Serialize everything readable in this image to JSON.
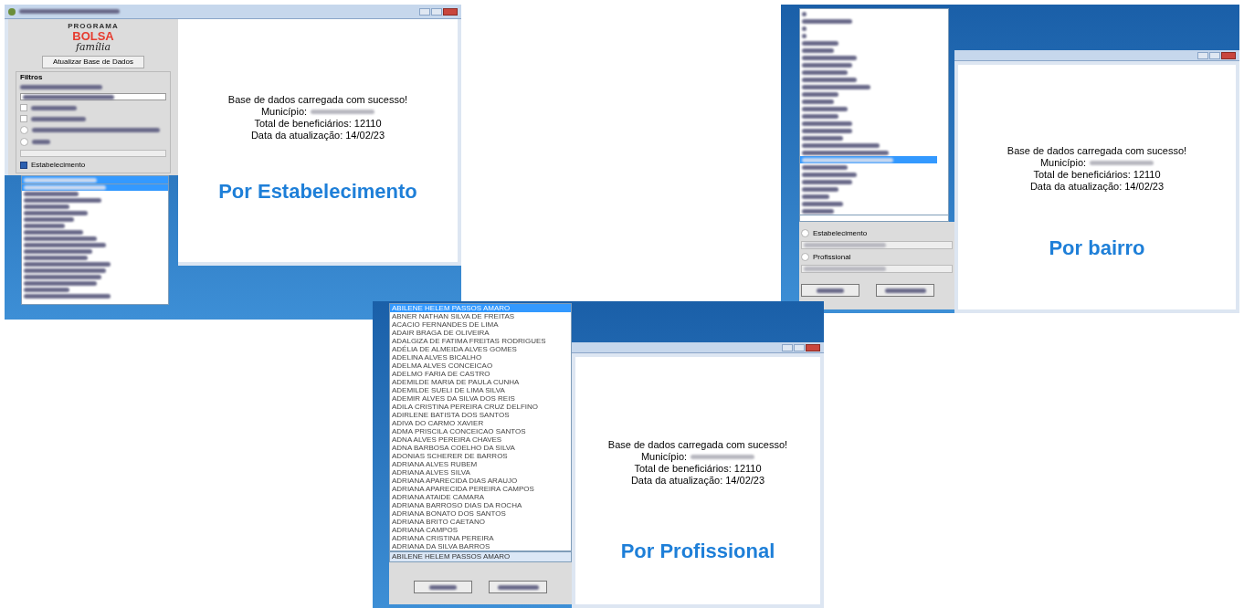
{
  "screens": [
    {
      "kind": "establishment",
      "logo": {
        "top": "PROGRAMA",
        "main": "BOLSA",
        "script": "família"
      },
      "update_button": "Atualizar Base de Dados",
      "filter_group": "Filtros",
      "options": [
        {
          "kind": "checkbox",
          "checked": false
        },
        {
          "kind": "checkbox",
          "checked": false
        },
        {
          "kind": "radio",
          "selected": false
        },
        {
          "kind": "radio",
          "selected": false
        }
      ],
      "filter_option": {
        "label": "Estabelecimento",
        "checked": true
      },
      "dropdown_items": [
        {
          "selected": true
        },
        {
          "selected": false
        },
        {
          "selected": false
        },
        {
          "selected": false
        },
        {
          "selected": false
        },
        {
          "selected": false
        },
        {
          "selected": false
        },
        {
          "selected": false
        },
        {
          "selected": false
        },
        {
          "selected": false
        },
        {
          "selected": false
        },
        {
          "selected": false
        },
        {
          "selected": false
        },
        {
          "selected": false
        },
        {
          "selected": false
        },
        {
          "selected": false
        },
        {
          "selected": false
        },
        {
          "selected": false
        }
      ],
      "message": {
        "loaded": "Base de dados carregada com sucesso!",
        "municipality_label": "Município:",
        "total": "Total de beneficiários: 12110",
        "date": "Data da atualização: 14/02/23"
      },
      "caption": "Por Estabelecimento"
    },
    {
      "kind": "neighborhood",
      "dropdown_items": [
        {
          "selected": false
        },
        {
          "selected": false
        },
        {
          "selected": false
        },
        {
          "selected": false
        },
        {
          "selected": false
        },
        {
          "selected": false
        },
        {
          "selected": false
        },
        {
          "selected": false
        },
        {
          "selected": false
        },
        {
          "selected": false
        },
        {
          "selected": false
        },
        {
          "selected": false
        },
        {
          "selected": false
        },
        {
          "selected": false
        },
        {
          "selected": false
        },
        {
          "selected": false
        },
        {
          "selected": false
        },
        {
          "selected": false
        },
        {
          "selected": false
        },
        {
          "selected": false
        },
        {
          "selected": true
        },
        {
          "selected": false
        },
        {
          "selected": false
        },
        {
          "selected": false
        },
        {
          "selected": false
        },
        {
          "selected": false
        },
        {
          "selected": false
        },
        {
          "selected": false
        }
      ],
      "radios": [
        {
          "label": "Estabelecimento",
          "selected": false
        },
        {
          "label": "Profissional",
          "selected": false
        }
      ],
      "message": {
        "loaded": "Base de dados carregada com sucesso!",
        "municipality_label": "Município:",
        "total": "Total de beneficiários: 12110",
        "date": "Data da atualização: 14/02/23"
      },
      "caption": "Por bairro"
    },
    {
      "kind": "professional",
      "dropdown_items": [
        {
          "label": "ABILENE HELEM PASSOS AMARO",
          "selected": true
        },
        {
          "label": "ABNER NATHAN SILVA DE FREITAS",
          "selected": false
        },
        {
          "label": "ACACIO FERNANDES DE LIMA",
          "selected": false
        },
        {
          "label": "ADAIR BRAGA DE OLIVEIRA",
          "selected": false
        },
        {
          "label": "ADALGIZA DE FATIMA FREITAS RODRIGUES",
          "selected": false
        },
        {
          "label": "ADÉLIA DE ALMEIDA ALVES GOMES",
          "selected": false
        },
        {
          "label": "ADELINA ALVES BICALHO",
          "selected": false
        },
        {
          "label": "ADELMA ALVES CONCEICAO",
          "selected": false
        },
        {
          "label": "ADELMO FARIA DE CASTRO",
          "selected": false
        },
        {
          "label": "ADEMILDE MARIA DE PAULA CUNHA",
          "selected": false
        },
        {
          "label": "ADEMILDE SUELI DE LIMA SILVA",
          "selected": false
        },
        {
          "label": "ADEMIR ALVES DA SILVA DOS REIS",
          "selected": false
        },
        {
          "label": "ADILA CRISTINA PEREIRA CRUZ DELFINO",
          "selected": false
        },
        {
          "label": "ADIRLENE BATISTA DOS SANTOS",
          "selected": false
        },
        {
          "label": "ADIVA DO CARMO XAVIER",
          "selected": false
        },
        {
          "label": "ADMA PRISCILA CONCEICAO SANTOS",
          "selected": false
        },
        {
          "label": "ADNA ALVES PEREIRA CHAVES",
          "selected": false
        },
        {
          "label": "ADNA BARBOSA COELHO DA SILVA",
          "selected": false
        },
        {
          "label": "ADONIAS SCHERER DE BARROS",
          "selected": false
        },
        {
          "label": "ADRIANA ALVES RUBEM",
          "selected": false
        },
        {
          "label": "ADRIANA ALVES SILVA",
          "selected": false
        },
        {
          "label": "ADRIANA APARECIDA DIAS ARAUJO",
          "selected": false
        },
        {
          "label": "ADRIANA APARECIDA PEREIRA CAMPOS",
          "selected": false
        },
        {
          "label": "ADRIANA ATAIDE CAMARA",
          "selected": false
        },
        {
          "label": "ADRIANA BARROSO DIAS DA ROCHA",
          "selected": false
        },
        {
          "label": "ADRIANA BONATO DOS SANTOS",
          "selected": false
        },
        {
          "label": "ADRIANA BRITO CAETANO",
          "selected": false
        },
        {
          "label": "ADRIANA CAMPOS",
          "selected": false
        },
        {
          "label": "ADRIANA CRISTINA PEREIRA",
          "selected": false
        },
        {
          "label": "ADRIANA DA SILVA BARROS",
          "selected": false
        }
      ],
      "field_value": "ABILENE HELEM PASSOS AMARO",
      "message": {
        "loaded": "Base de dados carregada com sucesso!",
        "municipality_label": "Município:",
        "total": "Total de beneficiários: 12110",
        "date": "Data da atualização: 14/02/23"
      },
      "caption": "Por Profissional"
    }
  ]
}
